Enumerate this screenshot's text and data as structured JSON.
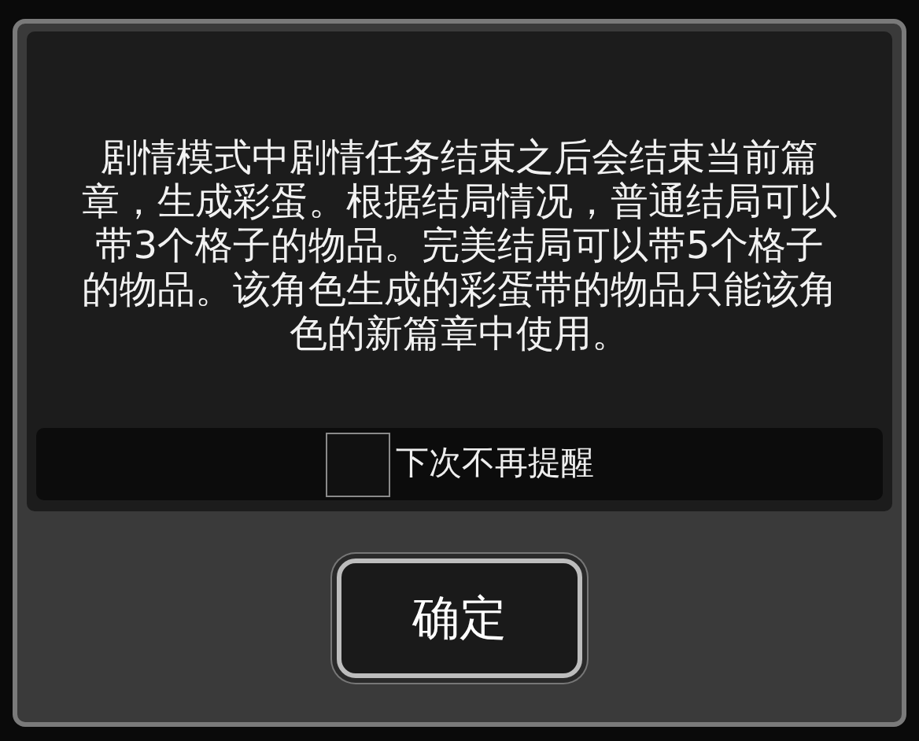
{
  "dialog": {
    "message": "剧情模式中剧情任务结束之后会结束当前篇章，生成彩蛋。根据结局情况，普通结局可以带3个格子的物品。完美结局可以带5个格子的物品。该角色生成的彩蛋带的物品只能该角色的新篇章中使用。",
    "dont_remind": {
      "label": "下次不再提醒",
      "checked": false
    },
    "confirm_button": "确定"
  }
}
